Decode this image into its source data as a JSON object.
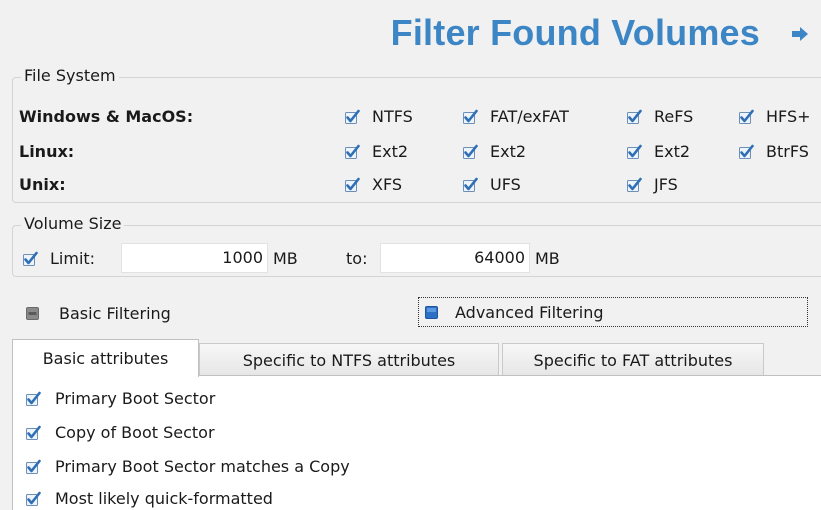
{
  "header": {
    "title": "Filter Found Volumes"
  },
  "file_system": {
    "legend": "File System",
    "rows": [
      {
        "label": "Windows & MacOS:",
        "options": [
          "NTFS",
          "FAT/exFAT",
          "ReFS",
          "HFS+"
        ]
      },
      {
        "label": "Linux:",
        "options": [
          "Ext2",
          "Ext2",
          "Ext2",
          "BtrFS"
        ]
      },
      {
        "label": "Unix:",
        "options": [
          "XFS",
          "UFS",
          "JFS"
        ]
      }
    ]
  },
  "volume_size": {
    "legend": "Volume Size",
    "limit_label": "Limit:",
    "from_value": "1000",
    "from_unit": "MB",
    "to_label": "to:",
    "to_value": "64000",
    "to_unit": "MB"
  },
  "filtering": {
    "basic_label": "Basic Filtering",
    "advanced_label": "Advanced Filtering"
  },
  "tabs": [
    {
      "label": "Basic attributes"
    },
    {
      "label": "Specific to NTFS attributes"
    },
    {
      "label": "Specific to FAT attributes"
    }
  ],
  "attributes": [
    {
      "label": "Primary Boot Sector"
    },
    {
      "label": "Copy of Boot Sector"
    },
    {
      "label": "Primary Boot Sector matches a Copy"
    },
    {
      "label": "Most likely quick-formatted"
    }
  ],
  "colors": {
    "title": "#3d86c6",
    "check": "#2f6fb5",
    "radio_selected": "#2c6fc4"
  }
}
